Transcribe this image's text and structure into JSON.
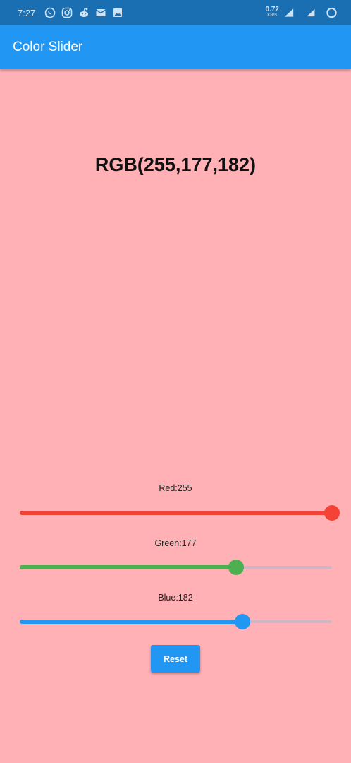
{
  "status_bar": {
    "time": "7:27",
    "net_speed_value": "0.72",
    "net_speed_unit": "KB/S",
    "icons": [
      "whatsapp-icon",
      "instagram-icon",
      "reddit-icon",
      "gmail-icon",
      "gallery-icon"
    ],
    "right_icons": [
      "signal-r-icon",
      "signal-4g-icon",
      "battery-ring-icon"
    ],
    "bg_color": "#1a6fb3"
  },
  "app_bar": {
    "title": "Color Slider",
    "color": "#2196f3"
  },
  "color_display": {
    "text": "RGB(255,177,182)",
    "background": "#ffb1b6"
  },
  "sliders": [
    {
      "label": "Red:255",
      "value": 255,
      "max": 255,
      "color": "#f44336"
    },
    {
      "label": "Green:177",
      "value": 177,
      "max": 255,
      "color": "#4caf50"
    },
    {
      "label": "Blue:182",
      "value": 182,
      "max": 255,
      "color": "#2196f3"
    }
  ],
  "reset_button": {
    "label": "Reset"
  }
}
